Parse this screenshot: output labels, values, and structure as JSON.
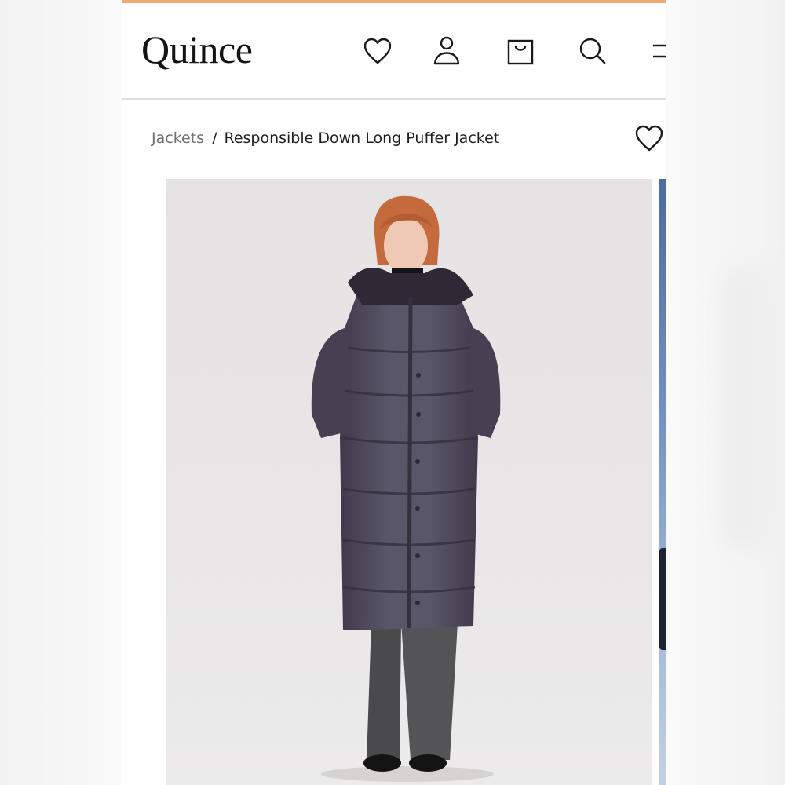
{
  "brand": {
    "logo_text": "Quince",
    "accent_color": "#f0a874"
  },
  "header": {
    "icons": [
      "heart-icon",
      "user-icon",
      "shopping-bag-icon",
      "search-icon",
      "menu-icon"
    ]
  },
  "breadcrumb": {
    "parent": "Jackets",
    "separator": "/",
    "current": "Responsible Down Long Puffer Jacket"
  },
  "product": {
    "image_alt": "Model wearing a long purple-gray hooded puffer coat",
    "coat_color": "#4f4b5c",
    "background_color": "#e6e4e4"
  }
}
